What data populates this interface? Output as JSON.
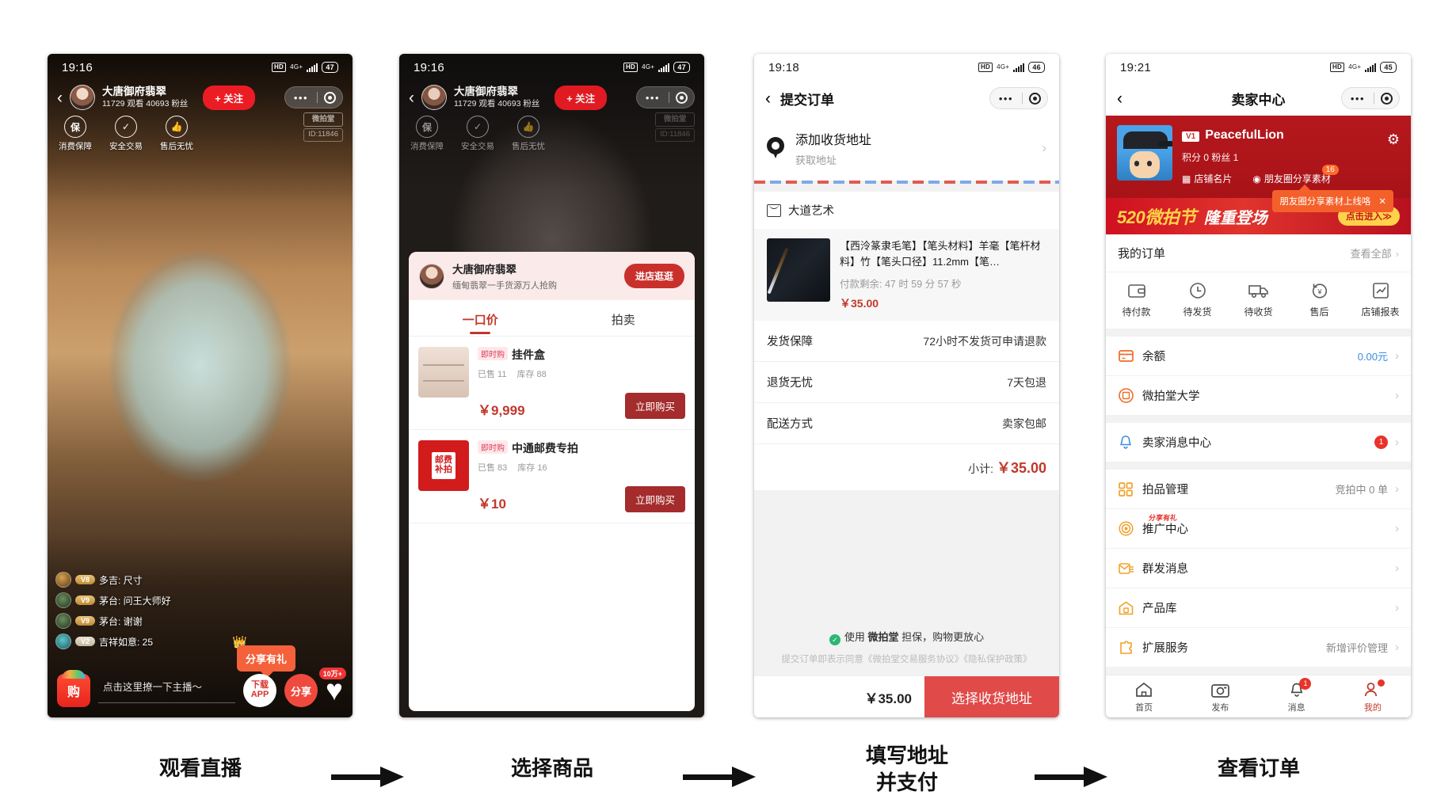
{
  "phone1": {
    "status": {
      "time": "19:16",
      "hd": "HD",
      "net": "4G+",
      "battery": "47"
    },
    "host": {
      "name": "大唐御府翡翠",
      "stats": "11729 观看  40693 粉丝",
      "follow": "+ 关注"
    },
    "badges": [
      {
        "icon": "保",
        "label": "消费保障"
      },
      {
        "icon": "✓",
        "label": "安全交易"
      },
      {
        "icon": "👍",
        "label": "售后无忧"
      }
    ],
    "watermark": {
      "brand": "微拍堂",
      "id": "ID:11846"
    },
    "chat": [
      {
        "level": "V8",
        "text": "多吉: 尺寸"
      },
      {
        "level": "V9",
        "text": "茅台: 问王大师好"
      },
      {
        "level": "V9",
        "text": "茅台: 谢谢"
      },
      {
        "level": "V2",
        "text": "吉祥如意: 25"
      }
    ],
    "share_tip": "分享有礼",
    "bottom": {
      "bag": "购",
      "say_placeholder": "点击这里撩一下主播～",
      "download": "下载\nAPP",
      "dl_line1": "下载",
      "dl_line2": "APP",
      "share": "分享",
      "like_count": "10万+"
    }
  },
  "phone2": {
    "status": {
      "time": "19:16",
      "hd": "HD",
      "net": "4G+",
      "battery": "47"
    },
    "host": {
      "name": "大唐御府翡翠",
      "stats": "11729 观看  40693 粉丝",
      "follow": "+ 关注"
    },
    "badges": [
      {
        "icon": "保",
        "label": "消费保障"
      },
      {
        "icon": "✓",
        "label": "安全交易"
      },
      {
        "icon": "👍",
        "label": "售后无忧"
      }
    ],
    "watermark": {
      "brand": "微拍堂",
      "id": "ID:11846"
    },
    "shop": {
      "name": "大唐御府翡翠",
      "desc": "缅甸翡翠一手货源万人抢购",
      "enter_button": "进店逛逛"
    },
    "tabs": [
      {
        "label": "一口价",
        "active": true
      },
      {
        "label": "拍卖",
        "active": false
      }
    ],
    "products": [
      {
        "tag": "即时购",
        "title": "挂件盒",
        "sold_label": "已售 11",
        "stock_label": "库存 88",
        "price": "￥9,999",
        "buy_label": "立即购买"
      },
      {
        "tag": "即时购",
        "title": "中通邮费专拍",
        "sold_label": "已售 83",
        "stock_label": "库存 16",
        "price": "￥10",
        "buy_label": "立即购买",
        "stamp_line1": "邮费",
        "stamp_line2": "补拍"
      }
    ]
  },
  "phone3": {
    "status": {
      "time": "19:18",
      "hd": "HD",
      "net": "4G+",
      "battery": "46"
    },
    "nav_title": "提交订单",
    "address": {
      "main": "添加收货地址",
      "sub": "获取地址"
    },
    "store_name": "大道艺术",
    "item": {
      "title": "【西泠篆隶毛笔】【笔头材料】羊毫【笔杆材料】竹【笔头口径】11.2mm【笔…",
      "countdown": "付款剩余: 47 时 59 分 57 秒",
      "price": "￥35.00"
    },
    "rows": [
      {
        "key": "发货保障",
        "value": "72小时不发货可申请退款"
      },
      {
        "key": "退货无忧",
        "value": "7天包退"
      },
      {
        "key": "配送方式",
        "value": "卖家包邮"
      }
    ],
    "subtotal_label": "小计:",
    "subtotal_value": "￥35.00",
    "guarantee_pre": "使用 ",
    "guarantee_brand": "微拍堂",
    "guarantee_post": " 担保，购物更放心",
    "terms": "提交订单即表示同意《微拍堂交易服务协议》《隐私保护政策》",
    "pay_amount": "￥35.00",
    "pay_button": "选择收货地址"
  },
  "phone4": {
    "status": {
      "time": "19:21",
      "hd": "HD",
      "net": "4G+",
      "battery": "45"
    },
    "nav_title": "卖家中心",
    "profile": {
      "vtag": "V1",
      "name": "PeacefulLion",
      "stats": "积分 0 粉丝 1",
      "link1": "店铺名片",
      "link2": "朋友圈分享素材",
      "link2_badge": "16"
    },
    "tip": {
      "text": "朋友圈分享素材上线咯",
      "close": "✕"
    },
    "banner": {
      "part1": "520微拍节",
      "part2": "隆重登场",
      "cta": "点击进入≫"
    },
    "orders": {
      "title": "我的订单",
      "more": "查看全部",
      "items": [
        {
          "icon": "wallet-icon",
          "label": "待付款"
        },
        {
          "icon": "clock-icon",
          "label": "待发货"
        },
        {
          "icon": "truck-icon",
          "label": "待收货"
        },
        {
          "icon": "refund-icon",
          "label": "售后"
        },
        {
          "icon": "report-icon",
          "label": "店铺报表"
        }
      ]
    },
    "menu": [
      {
        "icon": "card-icon",
        "label": "余额",
        "right": "0.00元",
        "right_color": "blue",
        "badge": "",
        "ribbon": ""
      },
      {
        "icon": "university-icon",
        "label": "微拍堂大学",
        "right": "",
        "badge": "",
        "ribbon": ""
      },
      {
        "icon": "bell-icon",
        "label": "卖家消息中心",
        "right": "",
        "badge": "1",
        "ribbon": ""
      },
      {
        "icon": "grid-icon",
        "label": "拍品管理",
        "right": "竞拍中 0 单",
        "badge": "",
        "ribbon": ""
      },
      {
        "icon": "target-icon",
        "label": "推广中心",
        "right": "",
        "badge": "",
        "ribbon": "分享有礼"
      },
      {
        "icon": "mail-icon",
        "label": "群发消息",
        "right": "",
        "badge": "",
        "ribbon": ""
      },
      {
        "icon": "warehouse-icon",
        "label": "产品库",
        "right": "",
        "badge": "",
        "ribbon": ""
      },
      {
        "icon": "puzzle-icon",
        "label": "扩展服务",
        "right": "新增评价管理",
        "badge": "",
        "ribbon": ""
      }
    ],
    "tabbar": [
      {
        "icon": "home-icon",
        "label": "首页",
        "active": false,
        "badge": ""
      },
      {
        "icon": "camera-icon",
        "label": "发布",
        "active": false,
        "badge": ""
      },
      {
        "icon": "bell-icon",
        "label": "消息",
        "active": false,
        "badge": "1"
      },
      {
        "icon": "person-icon",
        "label": "我的",
        "active": true,
        "badge": "dot"
      }
    ]
  },
  "captions": {
    "step1": "观看直播",
    "step2": "选择商品",
    "step3_line1": "填写地址",
    "step3_line2": "并支付",
    "step4": "查看订单"
  },
  "colors": {
    "brand_red": "#c0392b",
    "live_red": "#ec1c24",
    "accent_orange": "#f4602a",
    "link_blue": "#3b8ee0"
  }
}
